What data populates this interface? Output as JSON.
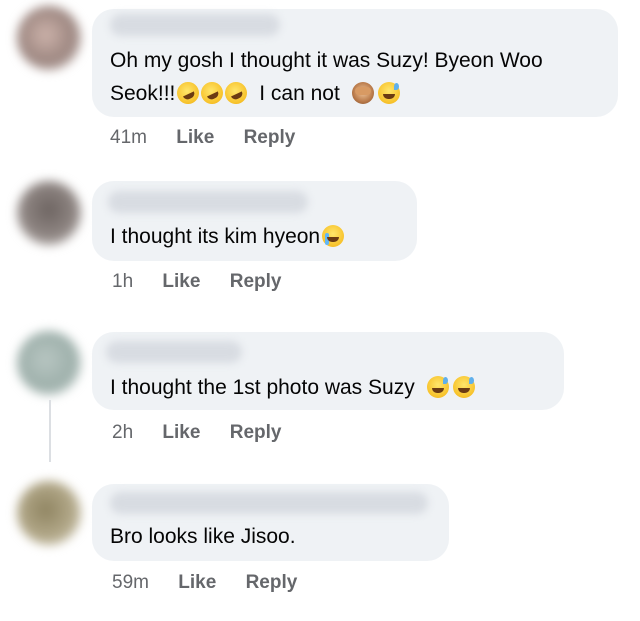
{
  "comments": [
    {
      "text_line1": "Oh my gosh I thought it was Suzy! Byeon Woo",
      "text_line2": "Seok!!!",
      "text_line2_suffix": "I can not",
      "time": "41m",
      "like": "Like",
      "reply": "Reply"
    },
    {
      "text": "I thought its kim hyeon",
      "time": "1h",
      "like": "Like",
      "reply": "Reply"
    },
    {
      "text": "I thought the 1st photo was Suzy",
      "time": "2h",
      "like": "Like",
      "reply": "Reply"
    },
    {
      "text": "Bro looks like Jisoo.",
      "time": "59m",
      "like": "Like",
      "reply": "Reply"
    }
  ],
  "icons": {
    "rofl": "rolling-on-floor-laughing-emoji",
    "see_no_evil": "see-no-evil-monkey-emoji",
    "sweat_smile": "grinning-sweat-emoji",
    "cry": "loudly-crying-emoji"
  },
  "colors": {
    "bubble": "#eff2f5",
    "meta_text": "#65676b",
    "text": "#050505"
  }
}
